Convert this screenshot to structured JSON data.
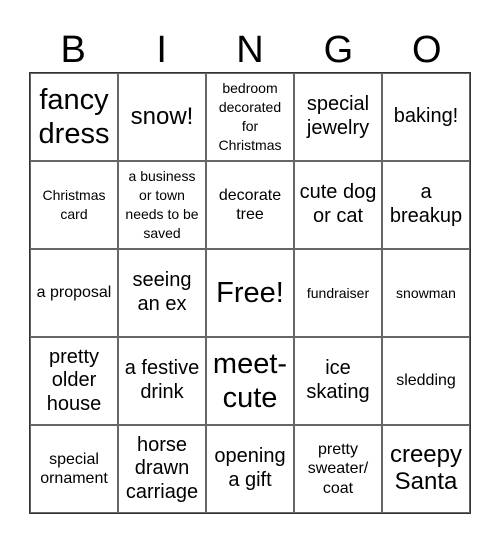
{
  "header": {
    "letters": [
      "B",
      "I",
      "N",
      "G",
      "O"
    ]
  },
  "cells": [
    {
      "text": "fancy dress",
      "size": "s-xl"
    },
    {
      "text": "snow!",
      "size": "s-l"
    },
    {
      "text": "bedroom decorated for Christmas",
      "size": "s-xs"
    },
    {
      "text": "special jewelry",
      "size": "s-m"
    },
    {
      "text": "baking!",
      "size": "s-m"
    },
    {
      "text": "Christmas card",
      "size": "s-xs"
    },
    {
      "text": "a business or town needs to be saved",
      "size": "s-xs"
    },
    {
      "text": "decorate tree",
      "size": "s-s"
    },
    {
      "text": "cute dog or cat",
      "size": "s-m"
    },
    {
      "text": "a breakup",
      "size": "s-m"
    },
    {
      "text": "a proposal",
      "size": "s-s"
    },
    {
      "text": "seeing an ex",
      "size": "s-m"
    },
    {
      "text": "Free!",
      "size": "s-xl"
    },
    {
      "text": "fundraiser",
      "size": "s-xs"
    },
    {
      "text": "snowman",
      "size": "s-xs"
    },
    {
      "text": "pretty older house",
      "size": "s-m"
    },
    {
      "text": "a festive drink",
      "size": "s-m"
    },
    {
      "text": "meet-cute",
      "size": "s-xl"
    },
    {
      "text": "ice skating",
      "size": "s-m"
    },
    {
      "text": "sledding",
      "size": "s-s"
    },
    {
      "text": "special ornament",
      "size": "s-s"
    },
    {
      "text": "horse drawn carriage",
      "size": "s-m"
    },
    {
      "text": "opening a gift",
      "size": "s-m"
    },
    {
      "text": "pretty sweater/ coat",
      "size": "s-s"
    },
    {
      "text": "creepy Santa",
      "size": "s-l"
    }
  ]
}
